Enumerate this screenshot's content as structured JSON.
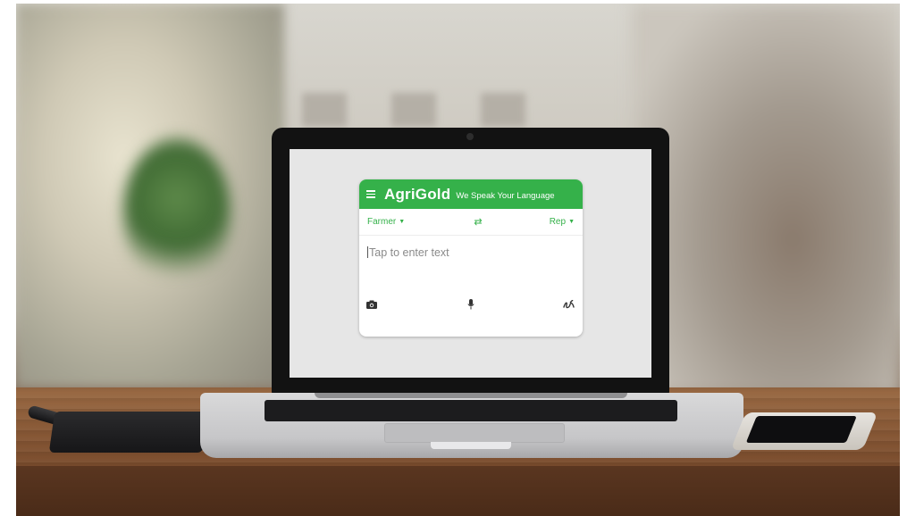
{
  "app": {
    "brand": "AgriGold",
    "tagline": "We Speak Your Language",
    "source_language": "Farmer",
    "target_language": "Rep",
    "swap_glyph": "⇄",
    "input_placeholder": "Tap to enter text"
  },
  "icons": {
    "menu": "menu-icon",
    "swap": "swap-languages-icon",
    "camera": "camera-icon",
    "microphone": "microphone-icon",
    "handwriting": "handwriting-icon",
    "dropdown": "caret-down-icon"
  },
  "colors": {
    "brand_green": "#35b14a",
    "screen_background": "#e6e6e6",
    "card_background": "#ffffff"
  }
}
